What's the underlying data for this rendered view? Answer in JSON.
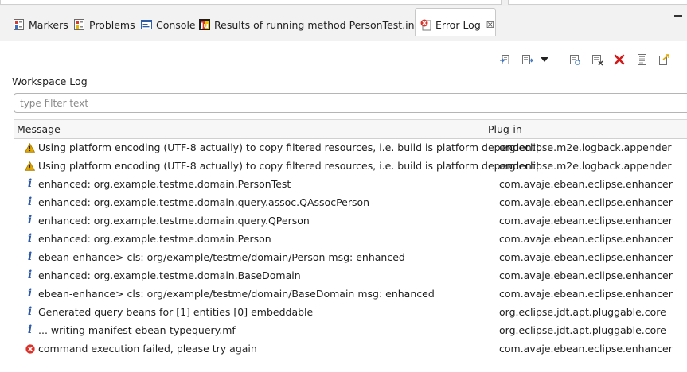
{
  "tabs": [
    {
      "label": "Markers",
      "icon": "markers-icon"
    },
    {
      "label": "Problems",
      "icon": "problems-icon"
    },
    {
      "label": "Console",
      "icon": "console-icon"
    },
    {
      "label": "Results of running method PersonTest.insert",
      "icon": "junit-results-icon"
    }
  ],
  "active_tab": {
    "label": "Error Log",
    "icon": "error-log-icon",
    "close": "☒"
  },
  "view": {
    "title": "Workspace Log",
    "filter_placeholder": "type filter text"
  },
  "table": {
    "columns": [
      "Message",
      "Plug-in"
    ],
    "rows": [
      {
        "severity": "warning",
        "message": "Using platform encoding (UTF-8 actually) to copy filtered resources, i.e. build is platform dependent!",
        "plugin": "org.eclipse.m2e.logback.appender"
      },
      {
        "severity": "warning",
        "message": "Using platform encoding (UTF-8 actually) to copy filtered resources, i.e. build is platform dependent!",
        "plugin": "org.eclipse.m2e.logback.appender"
      },
      {
        "severity": "info",
        "message": "enhanced: org.example.testme.domain.PersonTest",
        "plugin": "com.avaje.ebean.eclipse.enhancer"
      },
      {
        "severity": "info",
        "message": "enhanced: org.example.testme.domain.query.assoc.QAssocPerson",
        "plugin": "com.avaje.ebean.eclipse.enhancer"
      },
      {
        "severity": "info",
        "message": "enhanced: org.example.testme.domain.query.QPerson",
        "plugin": "com.avaje.ebean.eclipse.enhancer"
      },
      {
        "severity": "info",
        "message": "enhanced: org.example.testme.domain.Person",
        "plugin": "com.avaje.ebean.eclipse.enhancer"
      },
      {
        "severity": "info",
        "message": "ebean-enhance> cls: org/example/testme/domain/Person  msg: enhanced",
        "plugin": "com.avaje.ebean.eclipse.enhancer"
      },
      {
        "severity": "info",
        "message": "enhanced: org.example.testme.domain.BaseDomain",
        "plugin": "com.avaje.ebean.eclipse.enhancer"
      },
      {
        "severity": "info",
        "message": "ebean-enhance> cls: org/example/testme/domain/BaseDomain  msg: enhanced",
        "plugin": "com.avaje.ebean.eclipse.enhancer"
      },
      {
        "severity": "info",
        "message": "Generated query beans for [1] entities [0] embeddable",
        "plugin": "org.eclipse.jdt.apt.pluggable.core"
      },
      {
        "severity": "info",
        "message": "... writing manifest ebean-typequery.mf",
        "plugin": "org.eclipse.jdt.apt.pluggable.core"
      },
      {
        "severity": "error",
        "message": "command execution failed, please try again",
        "plugin": "com.avaje.ebean.eclipse.enhancer"
      }
    ]
  },
  "toolbar_icons": [
    "export-log-icon",
    "import-log-icon",
    "view-menu-dropdown-icon",
    "open-log-icon",
    "clear-log-icon",
    "delete-log-icon",
    "restore-log-icon",
    "export-entry-icon"
  ],
  "colors": {
    "info": "#2a57a8",
    "warning": "#e0a800",
    "error": "#d9342b",
    "delete": "#d01b1b"
  }
}
